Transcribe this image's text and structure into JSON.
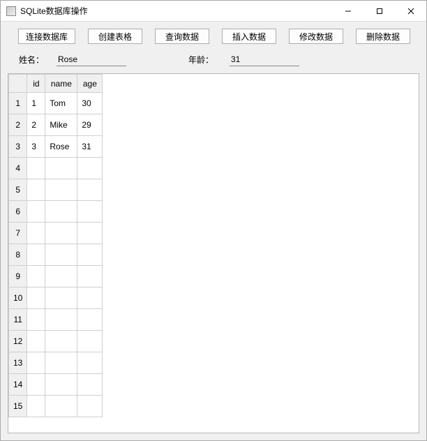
{
  "window": {
    "title": "SQLite数据库操作"
  },
  "toolbar": {
    "connect": "连接数据库",
    "create": "创建表格",
    "query": "查询数据",
    "insert": "插入数据",
    "update": "修改数据",
    "delete": "删除数据"
  },
  "form": {
    "name_label": "姓名：",
    "name_value": "Rose",
    "age_label": "年龄：",
    "age_value": "31"
  },
  "table": {
    "columns": [
      "id",
      "name",
      "age"
    ],
    "row_count": 15,
    "rows": [
      {
        "n": "1",
        "id": "1",
        "name": "Tom",
        "age": "30"
      },
      {
        "n": "2",
        "id": "2",
        "name": "Mike",
        "age": "29"
      },
      {
        "n": "3",
        "id": "3",
        "name": "Rose",
        "age": "31"
      },
      {
        "n": "4",
        "id": "",
        "name": "",
        "age": ""
      },
      {
        "n": "5",
        "id": "",
        "name": "",
        "age": ""
      },
      {
        "n": "6",
        "id": "",
        "name": "",
        "age": ""
      },
      {
        "n": "7",
        "id": "",
        "name": "",
        "age": ""
      },
      {
        "n": "8",
        "id": "",
        "name": "",
        "age": ""
      },
      {
        "n": "9",
        "id": "",
        "name": "",
        "age": ""
      },
      {
        "n": "10",
        "id": "",
        "name": "",
        "age": ""
      },
      {
        "n": "11",
        "id": "",
        "name": "",
        "age": ""
      },
      {
        "n": "12",
        "id": "",
        "name": "",
        "age": ""
      },
      {
        "n": "13",
        "id": "",
        "name": "",
        "age": ""
      },
      {
        "n": "14",
        "id": "",
        "name": "",
        "age": ""
      },
      {
        "n": "15",
        "id": "",
        "name": "",
        "age": ""
      }
    ]
  }
}
